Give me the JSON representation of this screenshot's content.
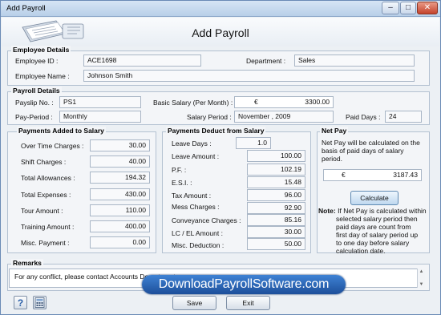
{
  "window": {
    "title": "Add Payroll",
    "minimize": "–",
    "maximize": "□",
    "close": "✕"
  },
  "header": {
    "title": "Add Payroll"
  },
  "employee": {
    "section": "Employee Details",
    "id_label": "Employee ID :",
    "id_value": "ACE1698",
    "dept_label": "Department :",
    "dept_value": "Sales",
    "name_label": "Employee Name :",
    "name_value": "Johnson Smith"
  },
  "payroll": {
    "section": "Payroll Details",
    "payslip_label": "Payslip No. :",
    "payslip_value": "PS1",
    "basic_label": "Basic Salary (Per Month) :",
    "currency": "€",
    "basic_value": "3300.00",
    "period_label": "Pay-Period :",
    "period_value": "Monthly",
    "salary_period_label": "Salary Period :",
    "salary_period_value": "November , 2009",
    "paid_days_label": "Paid Days :",
    "paid_days_value": "24"
  },
  "added": {
    "section": "Payments Added to Salary",
    "items": [
      {
        "label": "Over Time Charges :",
        "value": "30.00"
      },
      {
        "label": "Shift Charges :",
        "value": "40.00"
      },
      {
        "label": "Total Allowances :",
        "value": "194.32"
      },
      {
        "label": "Total Expenses :",
        "value": "430.00"
      },
      {
        "label": "Tour Amount :",
        "value": "110.00"
      },
      {
        "label": "Training Amount :",
        "value": "400.00"
      },
      {
        "label": "Misc. Payment :",
        "value": "0.00"
      }
    ]
  },
  "deduct": {
    "section": "Payments Deduct from Salary",
    "leave_days_label": "Leave Days :",
    "leave_days_value": "1.0",
    "items": [
      {
        "label": "Leave Amount :",
        "value": "100.00"
      },
      {
        "label": "P.F. :",
        "value": "102.19"
      },
      {
        "label": "E.S.I. :",
        "value": "15.48"
      },
      {
        "label": "Tax Amount :",
        "value": "96.00"
      },
      {
        "label": "Mess Charges :",
        "value": "92.90"
      },
      {
        "label": "Conveyance Charges :",
        "value": "85.16"
      },
      {
        "label": "LC / EL Amount :",
        "value": "30.00"
      },
      {
        "label": "Misc. Deduction :",
        "value": "50.00"
      }
    ]
  },
  "netpay": {
    "section": "Net Pay",
    "info_lines": [
      "Net Pay will be calculated on the",
      "basis of paid days of salary",
      "period."
    ],
    "currency": "€",
    "value": "3187.43",
    "calculate_label": "Calculate",
    "note_label": "Note:",
    "note_lines": [
      "If Net Pay is calculated within",
      "selected salary period then",
      "paid days are count from",
      "first day of salary period up",
      "to one day before salary",
      "calculation date."
    ]
  },
  "remarks": {
    "section": "Remarks",
    "text": "For any conflict, please contact Accounts Department."
  },
  "watermark": "DownloadPayrollSoftware.com",
  "footer": {
    "save_label": "Save",
    "exit_label": "Exit"
  }
}
